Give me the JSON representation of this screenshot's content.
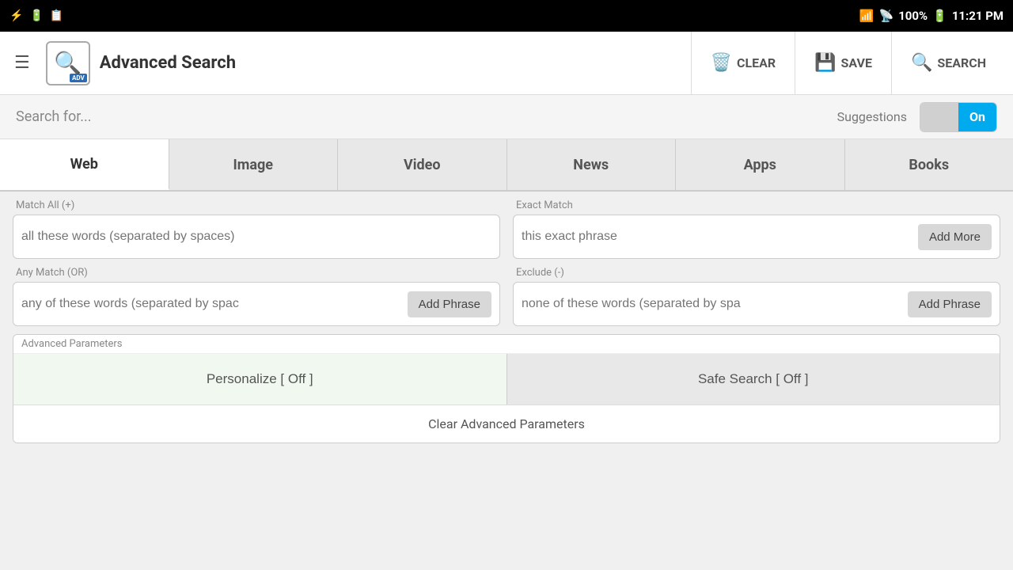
{
  "statusBar": {
    "time": "11:21 PM",
    "battery": "100%",
    "batteryIcon": "🔋",
    "wifiIcon": "WiFi",
    "signalIcon": "Signal"
  },
  "topBar": {
    "appTitle": "Advanced Search",
    "clearLabel": "CLEAR",
    "saveLabel": "SAVE",
    "searchLabel": "SEARCH"
  },
  "searchFor": {
    "label": "Search for...",
    "suggestionsLabel": "Suggestions",
    "toggleOn": "On"
  },
  "tabs": [
    {
      "id": "web",
      "label": "Web",
      "active": true
    },
    {
      "id": "image",
      "label": "Image",
      "active": false
    },
    {
      "id": "video",
      "label": "Video",
      "active": false
    },
    {
      "id": "news",
      "label": "News",
      "active": false
    },
    {
      "id": "apps",
      "label": "Apps",
      "active": false
    },
    {
      "id": "books",
      "label": "Books",
      "active": false
    }
  ],
  "fields": {
    "matchAll": {
      "groupLabel": "Match All (+)",
      "placeholder": "all these words (separated by spaces)"
    },
    "exactMatch": {
      "groupLabel": "Exact Match",
      "placeholder": "this exact phrase",
      "addMoreLabel": "Add More"
    },
    "anyMatch": {
      "groupLabel": "Any Match (OR)",
      "placeholder": "any of these words (separated by spac",
      "addPhraseLabel": "Add Phrase"
    },
    "exclude": {
      "groupLabel": "Exclude (-)",
      "placeholder": "none of these words (separated by spa",
      "addPhraseLabel": "Add Phrase"
    }
  },
  "advancedParams": {
    "sectionLabel": "Advanced Parameters",
    "personalizeLabel": "Personalize [ Off ]",
    "safeSearchLabel": "Safe Search [ Off ]",
    "clearParamsLabel": "Clear Advanced Parameters"
  }
}
